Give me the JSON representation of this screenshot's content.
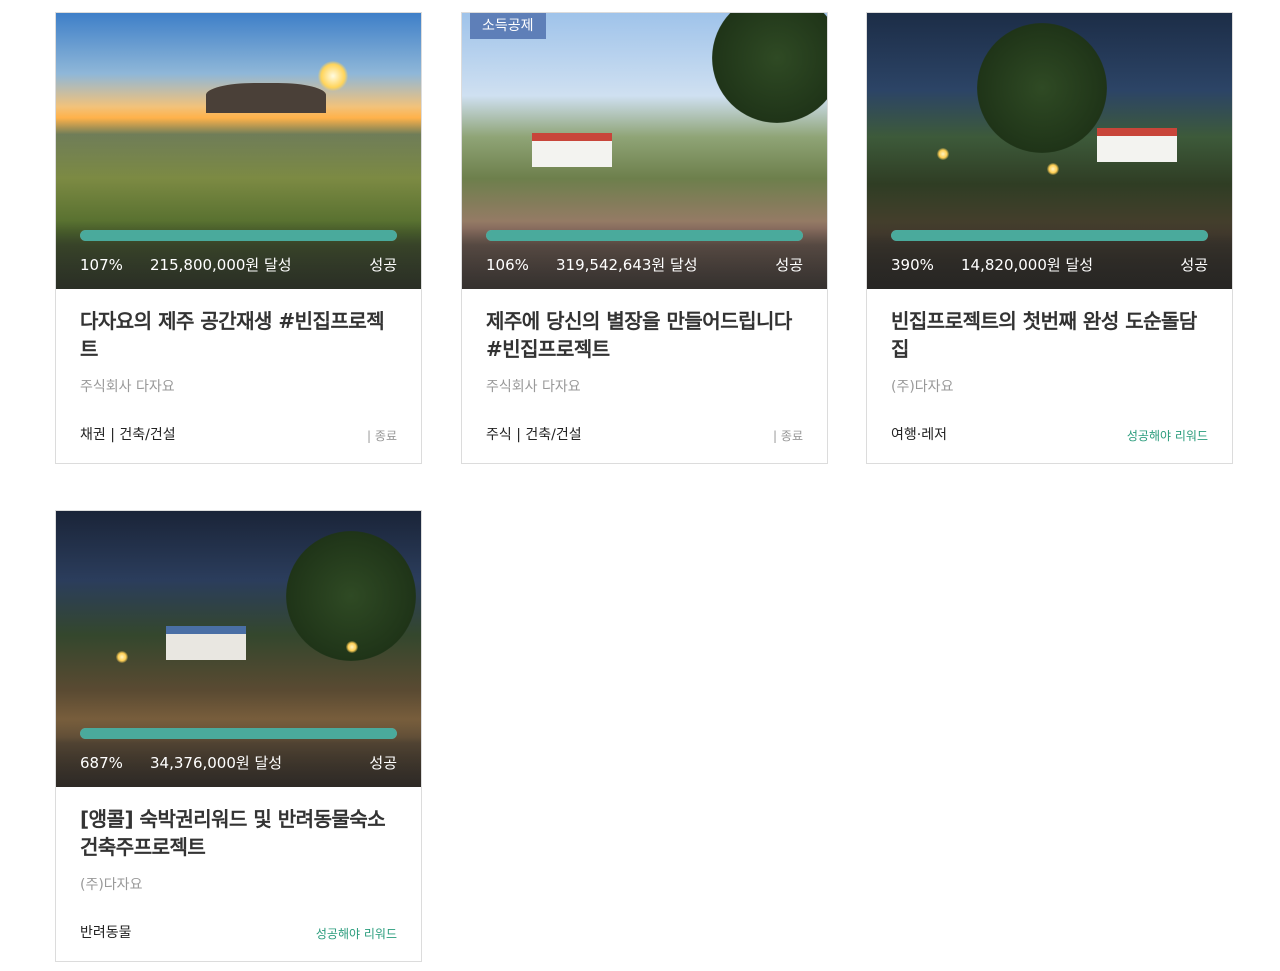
{
  "colors": {
    "progress": "#4aaa9c",
    "badge": "#5e7fb8",
    "reward": "#2a9c7c",
    "muted": "#999999"
  },
  "cards": [
    {
      "badge": "",
      "progress_fraction": 1.0,
      "percent": "107%",
      "amount": "215,800,000원 달성",
      "status": "성공",
      "title": "다자요의 제주 공간재생 #빈집프로젝트",
      "company": "주식회사 다자요",
      "category": "채권 | 건축/건설",
      "state": "| 종료"
    },
    {
      "badge": "소득공제",
      "progress_fraction": 1.0,
      "percent": "106%",
      "amount": "319,542,643원 달성",
      "status": "성공",
      "title": "제주에 당신의 별장을 만들어드립니다 #빈집프로젝트",
      "company": "주식회사 다자요",
      "category": "주식 | 건축/건설",
      "state": "| 종료"
    },
    {
      "badge": "",
      "progress_fraction": 1.0,
      "percent": "390%",
      "amount": "14,820,000원 달성",
      "status": "성공",
      "title": "빈집프로젝트의 첫번째 완성 도순돌담집",
      "company": "(주)다자요",
      "category": "여행·레저",
      "state": "성공해야 리워드"
    },
    {
      "badge": "",
      "progress_fraction": 1.0,
      "percent": "687%",
      "amount": "34,376,000원 달성",
      "status": "성공",
      "title": "[앵콜] 숙박권리워드 및 반려동물숙소 건축주프로젝트",
      "company": "(주)다자요",
      "category": "반려동물",
      "state": "성공해야 리워드"
    }
  ]
}
